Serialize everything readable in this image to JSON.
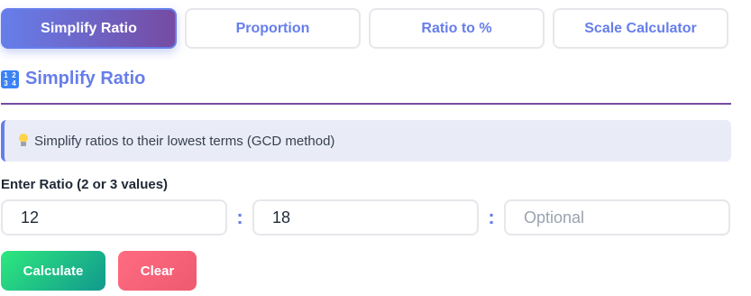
{
  "tabs": [
    {
      "label": "Simplify Ratio",
      "active": true
    },
    {
      "label": "Proportion",
      "active": false
    },
    {
      "label": "Ratio to %",
      "active": false
    },
    {
      "label": "Scale Calculator",
      "active": false
    }
  ],
  "section": {
    "icon": "input-numbers-icon",
    "title": "Simplify Ratio"
  },
  "info": {
    "icon": "light-bulb-icon",
    "text": "Simplify ratios to their lowest terms (GCD method)"
  },
  "form": {
    "label": "Enter Ratio (2 or 3 values)",
    "inputs": [
      {
        "value": "12",
        "placeholder": ""
      },
      {
        "value": "18",
        "placeholder": ""
      },
      {
        "value": "",
        "placeholder": "Optional"
      }
    ],
    "separator": ":"
  },
  "buttons": {
    "calculate": "Calculate",
    "clear": "Clear"
  },
  "colors": {
    "accent": "#667eea",
    "accent_dark": "#764ba2",
    "calculate": "#11998e",
    "clear": "#ee5a6f"
  }
}
